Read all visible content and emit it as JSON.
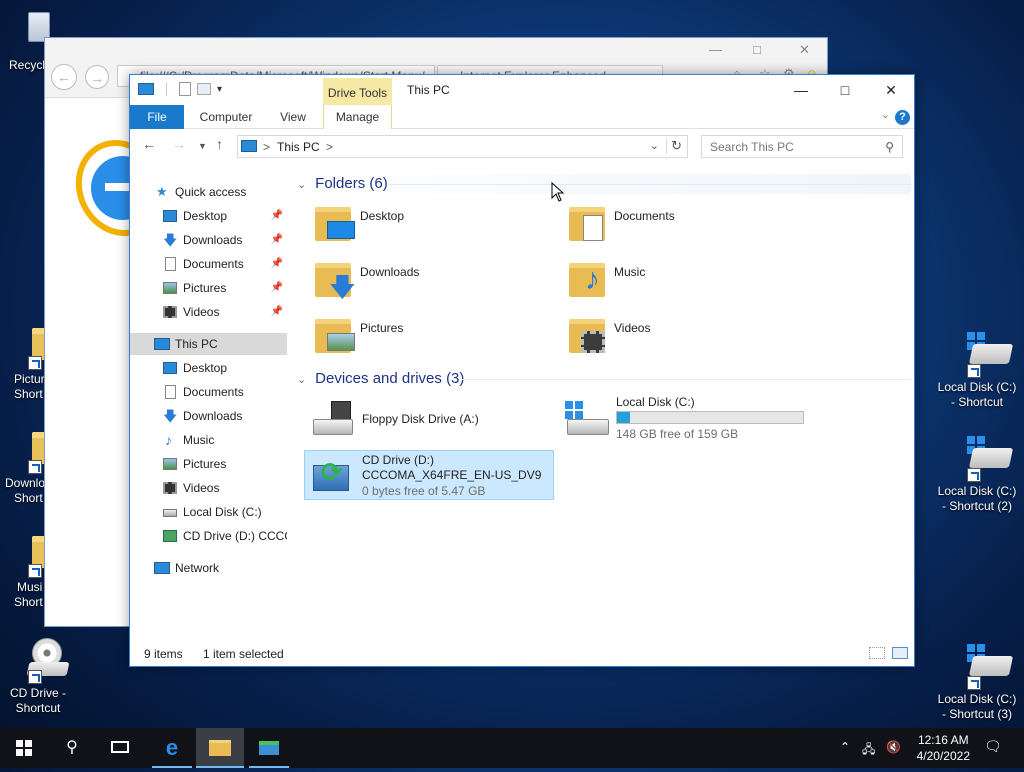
{
  "desktop": {
    "icons": [
      {
        "label": "Recycl"
      },
      {
        "label": "Pictur",
        "label2": "Short"
      },
      {
        "label": "Downlo",
        "label2": "Short"
      },
      {
        "label": "Musi",
        "label2": "Short"
      },
      {
        "label": "CD Drive -",
        "label2": "Shortcut"
      },
      {
        "label": "Local Disk (C:)",
        "label2": "- Shortcut"
      },
      {
        "label": "Local Disk (C:)",
        "label2": "- Shortcut (2)"
      },
      {
        "label": "Local Disk (C:)",
        "label2": "- Shortcut (3)"
      }
    ]
  },
  "ie": {
    "address": "file:///C:/ProgramData/Microsoft/Windows/Start Menu/...",
    "tab_title": "Internet Explorer Enhanced..."
  },
  "explorer": {
    "title": "This PC",
    "drive_tools": "Drive Tools",
    "ribbon_tabs": [
      "File",
      "Computer",
      "View",
      "Manage"
    ],
    "breadcrumb": "This PC",
    "breadcrumb_sep": ">",
    "search_placeholder": "Search This PC",
    "sidebar": {
      "quick_access": "Quick access",
      "qa_items": [
        "Desktop",
        "Downloads",
        "Documents",
        "Pictures",
        "Videos"
      ],
      "this_pc": "This PC",
      "pc_items": [
        "Desktop",
        "Documents",
        "Downloads",
        "Music",
        "Pictures",
        "Videos",
        "Local Disk (C:)",
        "CD Drive (D:) CCCOMA"
      ],
      "network": "Network"
    },
    "folders_header": "Folders (6)",
    "folders": [
      "Desktop",
      "Documents",
      "Downloads",
      "Music",
      "Pictures",
      "Videos"
    ],
    "devices_header": "Devices and drives (3)",
    "drives": {
      "floppy": {
        "name": "Floppy Disk Drive (A:)"
      },
      "local": {
        "name": "Local Disk (C:)",
        "free": "148 GB free of 159 GB",
        "used_fraction": 0.07
      },
      "cd": {
        "name": "CD Drive (D:)",
        "label": "CCCOMA_X64FRE_EN-US_DV9",
        "free": "0 bytes free of 5.47 GB"
      }
    },
    "status_items": "9 items",
    "status_selected": "1 item selected"
  },
  "taskbar": {
    "time": "12:16 AM",
    "date": "4/20/2022"
  },
  "colors": {
    "accent": "#1979ca",
    "selection": "#cce8ff",
    "drive_tools": "#f5e9a5",
    "capacity": "#26a0da"
  }
}
